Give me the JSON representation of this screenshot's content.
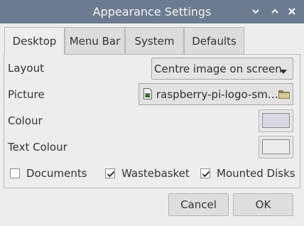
{
  "window": {
    "title": "Appearance Settings",
    "controls": {
      "minimize": "˅",
      "maximize": "˄",
      "close": "×"
    }
  },
  "tabs": [
    {
      "label": "Desktop",
      "active": true
    },
    {
      "label": "Menu Bar",
      "active": false
    },
    {
      "label": "System",
      "active": false
    },
    {
      "label": "Defaults",
      "active": false
    }
  ],
  "desktop": {
    "layout": {
      "label": "Layout",
      "value": "Centre image on screen"
    },
    "picture": {
      "label": "Picture",
      "value": "raspberry-pi-logo-sm…"
    },
    "colour": {
      "label": "Colour",
      "swatch": "#dad7e4"
    },
    "text_colour": {
      "label": "Text Colour",
      "swatch": "#ececec"
    },
    "checkboxes": [
      {
        "label": "Documents",
        "checked": false
      },
      {
        "label": "Wastebasket",
        "checked": true
      },
      {
        "label": "Mounted Disks",
        "checked": true
      }
    ]
  },
  "buttons": {
    "cancel": "Cancel",
    "ok": "OK"
  },
  "colors": {
    "titlebar": "#6c7b8f",
    "window_bg": "#ededed"
  },
  "icons": [
    "minimize-icon",
    "maximize-icon",
    "close-icon",
    "dropdown-arrow-icon",
    "image-file-icon",
    "folder-icon",
    "checkmark-icon"
  ]
}
